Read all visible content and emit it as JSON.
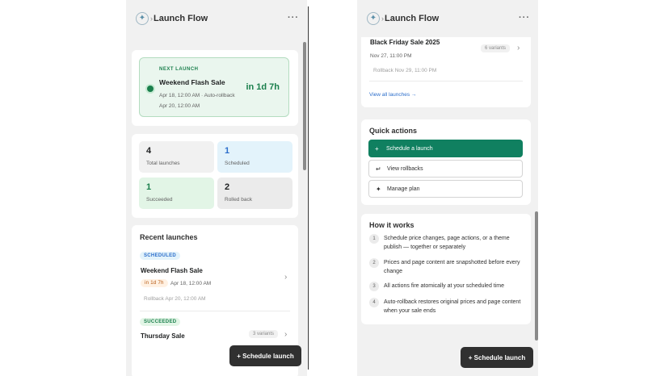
{
  "app": {
    "title": "Launch Flow",
    "menu_icon": "more-horizontal-icon"
  },
  "left": {
    "next_launch": {
      "tag": "NEXT LAUNCH",
      "name": "Weekend Flash Sale",
      "schedule": "Apr 18, 12:00 AM · Auto-rollback Apr 20, 12:00 AM",
      "countdown": "in 1d 7h"
    },
    "stats": [
      {
        "value": "4",
        "label": "Total launches"
      },
      {
        "value": "1",
        "label": "Scheduled"
      },
      {
        "value": "1",
        "label": "Succeeded"
      },
      {
        "value": "2",
        "label": "Rolled back"
      }
    ],
    "recent": {
      "title": "Recent launches",
      "items": [
        {
          "status": "SCHEDULED",
          "name": "Weekend Flash Sale",
          "countdown": "in 1d 7h",
          "date": "Apr 18, 12:00 AM",
          "rollback": "Rollback Apr 20, 12:00 AM"
        },
        {
          "status": "SUCCEEDED",
          "name": "Thursday Sale",
          "variants": "3 variants"
        }
      ]
    },
    "fab_label": "+ Schedule launch"
  },
  "right": {
    "launch": {
      "name": "Black Friday Sale 2025",
      "date": "Nov 27, 11:00 PM",
      "rollback": "Rollback Nov 29, 11:00 PM",
      "variants": "6 variants"
    },
    "view_all": "View all launches →",
    "quick_actions": {
      "title": "Quick actions",
      "buttons": [
        {
          "icon": "+",
          "label": "Schedule a launch"
        },
        {
          "icon": "↵",
          "label": "View rollbacks"
        },
        {
          "icon": "✦",
          "label": "Manage plan"
        }
      ]
    },
    "how_it_works": {
      "title": "How it works",
      "steps": [
        {
          "n": "1",
          "text": "Schedule price changes, page actions, or a theme publish — together or separately"
        },
        {
          "n": "2",
          "text": "Prices and page content are snapshotted before every change"
        },
        {
          "n": "3",
          "text": "All actions fire atomically at your scheduled time"
        },
        {
          "n": "4",
          "text": "Auto-rollback restores original prices and page content when your sale ends"
        }
      ]
    },
    "fab_label": "+ Schedule launch"
  },
  "colors": {
    "accent": "#108060",
    "success": "#1a7f4c",
    "info": "#2c6ecb",
    "dark": "#303030"
  }
}
